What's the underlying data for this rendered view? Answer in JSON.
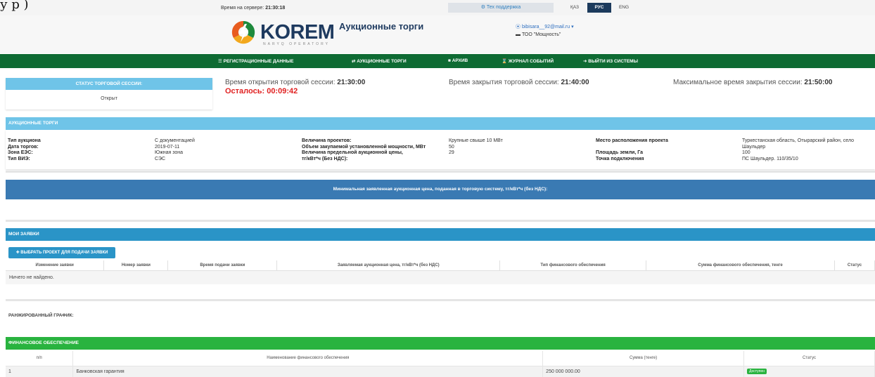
{
  "topbar": {
    "scribble": "у р )",
    "server_time_label": "Время на сервере:",
    "server_time": "21:30:18",
    "support": "⚙ Тех поддержка",
    "languages": [
      "ҚАЗ",
      "РУС",
      "ENG"
    ],
    "active_language": "РУС"
  },
  "header": {
    "logo_word": "KOREM",
    "logo_sub": "NARYQ OPERATORY",
    "app_title": "Аукционные торги",
    "user_email": "⦿ bibisara__92@mail.ru ▾",
    "user_org": "▬ ТОО \"Мощность\""
  },
  "nav": {
    "items": [
      "☰ РЕГИСТРАЦИОННЫЕ ДАННЫЕ",
      "⇄ АУКЦИОННЫЕ ТОРГИ",
      "■ АРХИВ",
      "⌛ ЖУРНАЛ СОБЫТИЙ",
      "➜ ВЫЙТИ ИЗ СИСТЕМЫ"
    ]
  },
  "session": {
    "status_title": "СТАТУС ТОРГОВОЙ СЕССИИ:",
    "status_value": "Открыт",
    "open_label": "Время открытия торговой сессии:",
    "open_time": "21:30:00",
    "remaining": "Осталось: 00:09:42",
    "close_label": "Время закрытия торговой сессии:",
    "close_time": "21:40:00",
    "max_label": "Максимальное время закрытия сессии:",
    "max_time": "21:50:00"
  },
  "auction": {
    "title": "АУКЦИОННЫЕ ТОРГИ",
    "col1_labels": "Тип аукциона\nДата торгов:\nЗона ЕЭС:\nТип ВИЭ:",
    "col1_values": "С документацией\n2019-07-11\nЮжная зона\nСЭС",
    "col2_labels": "Величина проектов:\nОбъем закупаемой установленной мощности, МВт\nВеличина предельной аукционной цены,\nтг/кВт*ч (Без НДС):",
    "col2_values": "Крупные свыше 10 МВт\n50\n29",
    "col3_labels": "Место расположения проекта\n\nПлощадь земли, Га\nТочка подключения",
    "col3_values": "Туркестанская область, Отырарский район, село\nШаульдер\n100\nПС Шаульдер. 110/35/10"
  },
  "min_price_bar": "Минимальная заявленная аукционная цена, поданная в торговую систему, тг/кВт*ч (без НДС):",
  "my_orders": {
    "title": "МОИ ЗАЯВКИ",
    "pick_button": "✚ ВЫБРАТЬ ПРОЕКТ ДЛЯ ПОДАЧИ ЗАЯВКИ",
    "columns": [
      "Изменение заявки",
      "Номер заявки",
      "Время подачи заявки",
      "Заявляемая аукционная цена, тг/кВт*ч (без НДС)",
      "Тип финансового обеспечения",
      "Сумма финансового обеспечения, тенге",
      "Статус"
    ],
    "empty": "Ничего не найдено."
  },
  "ranking_label": "РАНЖИРОВАННЫЙ ГРАФИК:",
  "finance": {
    "title": "ФИНАНСОВОЕ ОБЕСПЕЧЕНИЕ",
    "columns": [
      "п/п",
      "Наименование финансового обеспечения",
      "Сумма (тенге)",
      "Статус"
    ],
    "rows": [
      {
        "n": "1",
        "name": "Банковская гарантия",
        "sum": "250 000 000.00",
        "status": "Доступен"
      }
    ]
  },
  "colors": {
    "nav_green": "#0e6b33",
    "light_blue": "#6fc4e8",
    "steel_blue": "#3a7ab3",
    "blue": "#2a94c7",
    "fin_green": "#29b33f",
    "alert_red": "#e02020"
  }
}
